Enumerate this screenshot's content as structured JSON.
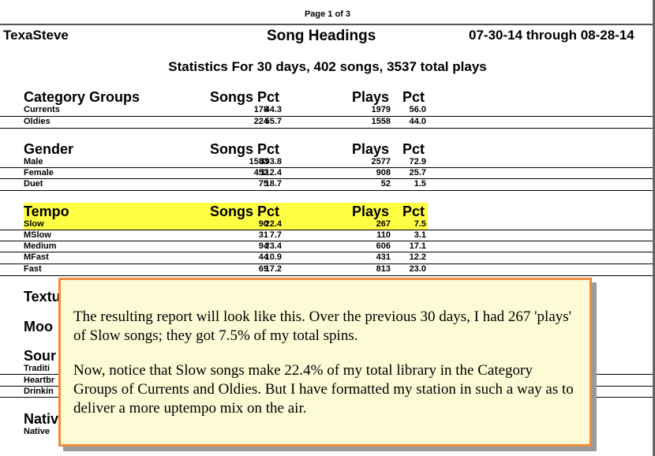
{
  "page_number": "Page 1 of 3",
  "header": {
    "left": "TexaSteve",
    "center": "Song Headings",
    "right": "07-30-14 through 08-28-14"
  },
  "stats": "Statistics For 30 days,  402 songs,  3537 total plays",
  "col_headers": {
    "songs": "Songs Pct",
    "plays": "Plays",
    "pct": "Pct"
  },
  "sections": {
    "category": {
      "title": "Category Groups",
      "rows": [
        {
          "label": "Currents",
          "songs": "178",
          "spct": "44.3",
          "plays": "1979",
          "ppct": "56.0"
        },
        {
          "label": "Oldies",
          "songs": "224",
          "spct": "55.7",
          "plays": "1558",
          "ppct": "44.0"
        }
      ]
    },
    "gender": {
      "title": "Gender",
      "rows": [
        {
          "label": "Male",
          "songs": "1583",
          "spct": "393.8",
          "plays": "2577",
          "ppct": "72.9"
        },
        {
          "label": "Female",
          "songs": "452",
          "spct": "112.4",
          "plays": "908",
          "ppct": "25.7"
        },
        {
          "label": "Duet",
          "songs": "75",
          "spct": "18.7",
          "plays": "52",
          "ppct": "1.5"
        }
      ]
    },
    "tempo": {
      "title": "Tempo",
      "rows": [
        {
          "label": "Slow",
          "songs": "90",
          "spct": "22.4",
          "plays": "267",
          "ppct": "7.5"
        },
        {
          "label": "MSlow",
          "songs": "31",
          "spct": "7.7",
          "plays": "110",
          "ppct": "3.1"
        },
        {
          "label": "Medium",
          "songs": "94",
          "spct": "23.4",
          "plays": "606",
          "ppct": "17.1"
        },
        {
          "label": "MFast",
          "songs": "44",
          "spct": "10.9",
          "plays": "431",
          "ppct": "12.2"
        },
        {
          "label": "Fast",
          "songs": "69",
          "spct": "17.2",
          "plays": "813",
          "ppct": "23.0"
        }
      ]
    },
    "hidden": {
      "textu": "Textu",
      "moo": "Moo",
      "sour": "Sour",
      "traditi": "Traditi",
      "heartbr": "Heartbr",
      "drinkin": "Drinkin",
      "nativ": "Nativ",
      "native": "Native"
    }
  },
  "callout": {
    "p1": "The resulting report will look like this. Over the previous 30 days, I had 267 'plays' of Slow songs; they got 7.5% of my total spins.",
    "p2": "Now, notice that Slow songs make 22.4% of my total library in the Category Groups of Currents and Oldies.  But I have formatted my station in such a way as to deliver a more uptempo mix on the air."
  },
  "colors": {
    "highlight": "#ffff44",
    "callout_bg": "#fdfbd5",
    "callout_border": "#f08a3c"
  }
}
